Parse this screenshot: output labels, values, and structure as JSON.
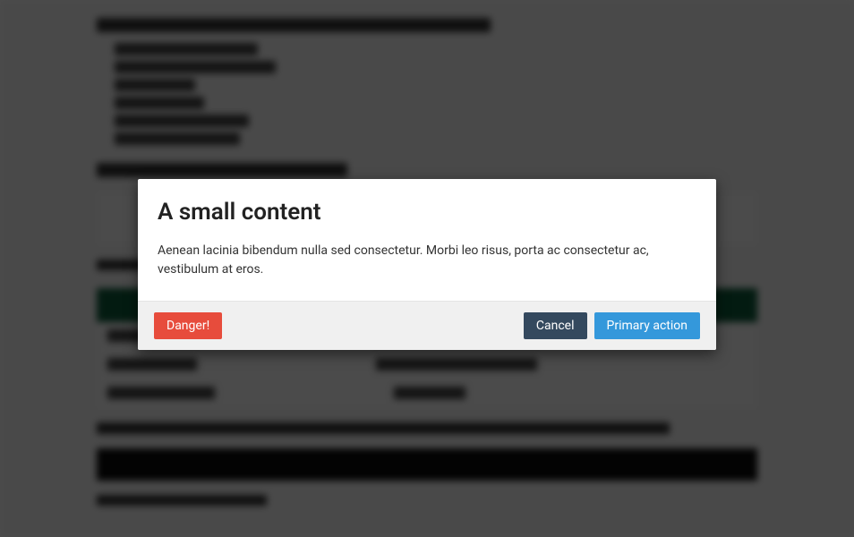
{
  "modal": {
    "title": "A small content",
    "body": "Aenean lacinia bibendum nulla sed consectetur. Morbi leo risus, porta ac consectetur ac, vestibulum at eros.",
    "buttons": {
      "danger": "Danger!",
      "cancel": "Cancel",
      "primary": "Primary action"
    }
  }
}
